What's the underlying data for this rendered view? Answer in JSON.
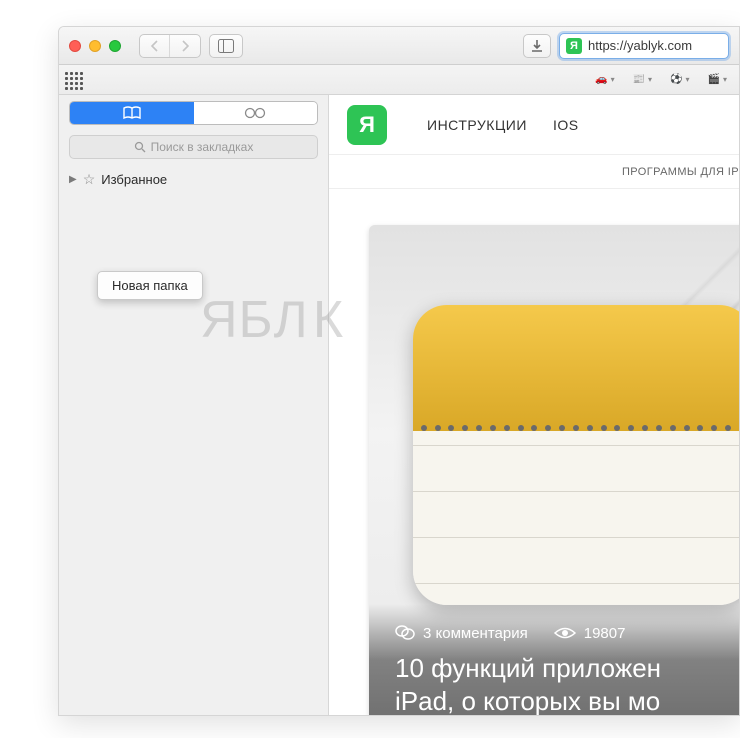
{
  "address_bar": {
    "url": "https://yablyk.com"
  },
  "sidebar": {
    "search_placeholder": "Поиск в закладках",
    "favorites_label": "Избранное",
    "context_menu": {
      "new_folder": "Новая папка"
    }
  },
  "nav": {
    "items": [
      "ИНСТРУКЦИИ",
      "IOS"
    ]
  },
  "subnav": {
    "label": "ПРОГРАММЫ ДЛЯ IP"
  },
  "article": {
    "comments_count": "3 комментария",
    "views": "19807",
    "headline_line1": "10 функций приложен",
    "headline_line2": "iPad, о которых вы мо"
  },
  "logo_letter": "Я",
  "watermark": "ЯБЛЫК"
}
